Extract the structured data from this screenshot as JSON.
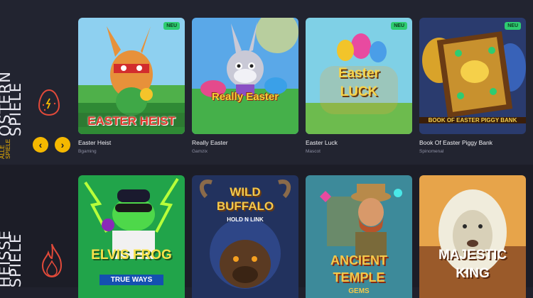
{
  "easter_section": {
    "title": "OSTERN\nSPIELE",
    "all_link": "ALLE\nSPIELE",
    "icon": "easter-egg-icon",
    "prev_icon": "chevron-left-icon",
    "next_icon": "chevron-right-icon",
    "prev_label": "‹",
    "next_label": "›",
    "games": [
      {
        "title": "Easter Heist",
        "provider": "Bgaming",
        "badge": "NEU",
        "art_text": "EASTER HEIST",
        "art_bg": "#8ed0f0"
      },
      {
        "title": "Really Easter",
        "provider": "Gamzix",
        "badge": "",
        "art_text": "Really Easter",
        "art_bg": "#5aa8e8"
      },
      {
        "title": "Easter Luck",
        "provider": "Mascot",
        "badge": "NEU",
        "art_text": "Easter LUCK",
        "art_bg": "#7fd0e6"
      },
      {
        "title": "Book Of Easter Piggy Bank",
        "provider": "Spinomenal",
        "badge": "NEU",
        "art_text": "BOOK OF EASTER PIGGY BANK",
        "art_bg": "#2a3b6e"
      }
    ]
  },
  "hot_section": {
    "title": "HEISSE\nSPIELE",
    "icon": "flame-icon",
    "games": [
      {
        "art_text": "ELVIS FROG",
        "art_sub": "TRUE WAYS",
        "art_bg": "#21a44a"
      },
      {
        "art_text": "WILD BUFFALO",
        "art_sub": "HOLD N LINK",
        "art_bg": "#22325e"
      },
      {
        "art_text": "ANCIENT TEMPLE",
        "art_sub": "GEMS",
        "art_bg": "#3d8a9a"
      },
      {
        "art_text": "MAJESTIC KING",
        "art_sub": "",
        "art_bg": "#e7a44a"
      }
    ]
  },
  "colors": {
    "accent": "#f5b800",
    "badge": "#2ecc71",
    "background": "#20212d"
  }
}
